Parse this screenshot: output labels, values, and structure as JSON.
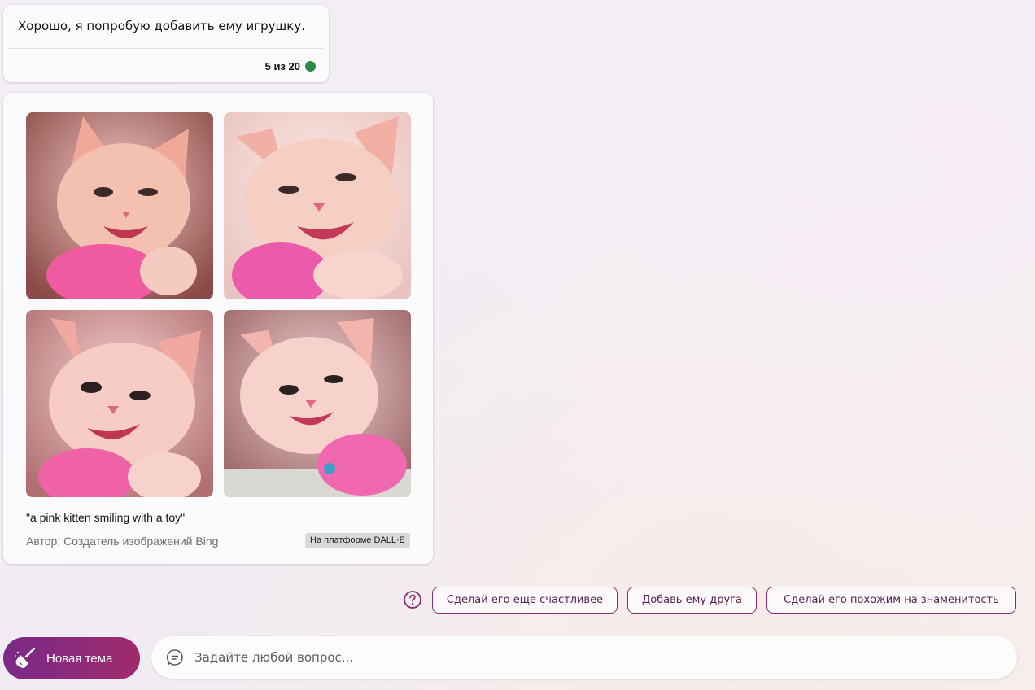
{
  "message": {
    "text": "Хорошо, я попробую добавить ему игрушку.",
    "counter": "5 из 20",
    "status_color": "#2e8b47"
  },
  "image_result": {
    "images": [
      {
        "icon": "pink-kitten-image-1"
      },
      {
        "icon": "pink-kitten-image-2"
      },
      {
        "icon": "pink-kitten-image-3"
      },
      {
        "icon": "pink-kitten-image-4"
      }
    ],
    "caption": "\"a pink kitten smiling with a toy\"",
    "author": "Автор: Создатель изображений Bing",
    "platform_badge": "На платформе DALL·E"
  },
  "suggestions": {
    "help_icon": "question-circle-icon",
    "chips": [
      {
        "label": "Сделай его еще счастливее"
      },
      {
        "label": "Добавь ему друга"
      },
      {
        "label": "Сделай его похожим на знаменитость"
      }
    ]
  },
  "input_bar": {
    "new_topic_label": "Новая тема",
    "new_topic_icon": "broom-icon",
    "placeholder": "Задайте любой вопрос...",
    "chat_icon": "chat-bubble-icon"
  },
  "colors": {
    "accent": "#8a2e72",
    "new_topic_gradient_start": "#7a2a86",
    "new_topic_gradient_end": "#a02a69"
  }
}
